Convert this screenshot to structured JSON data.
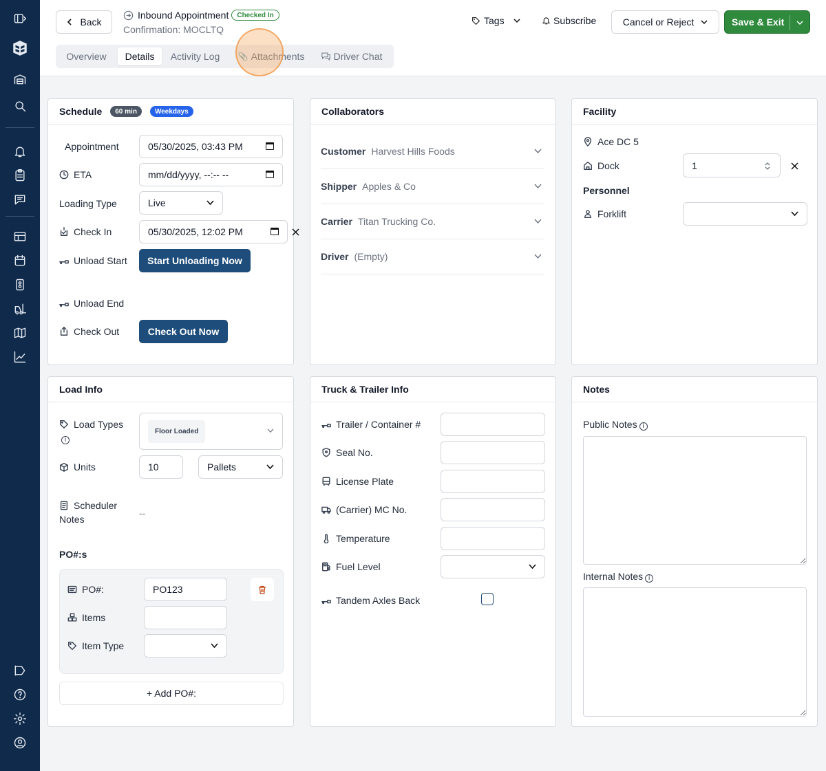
{
  "header": {
    "back_label": "Back",
    "title": "Inbound Appointment",
    "status_badge": "Checked In",
    "confirmation": "Confirmation: MOCLTQ",
    "tags_label": "Tags",
    "subscribe_label": "Subscribe",
    "cancel_label": "Cancel or Reject",
    "save_label": "Save & Exit",
    "tabs": [
      {
        "label": "Overview",
        "active": false
      },
      {
        "label": "Details",
        "active": true
      },
      {
        "label": "Activity Log",
        "active": false
      },
      {
        "label": "Attachments",
        "active": false
      },
      {
        "label": "Driver Chat",
        "active": false
      }
    ]
  },
  "schedule": {
    "title": "Schedule",
    "duration_badge": "60 min",
    "weekdays_badge": "Weekdays",
    "appointment_label": "Appointment",
    "appointment_value": "05/30/2025, 03:43 PM",
    "eta_label": "ETA",
    "eta_placeholder": "mm/dd/yyyy, --:-- --",
    "loading_type_label": "Loading Type",
    "loading_type_value": "Live",
    "check_in_label": "Check In",
    "check_in_value": "05/30/2025, 12:02 PM",
    "unload_start_label": "Unload Start",
    "start_unloading_label": "Start Unloading Now",
    "unload_end_label": "Unload End",
    "check_out_label": "Check Out",
    "check_out_button": "Check Out Now"
  },
  "collaborators": {
    "title": "Collaborators",
    "rows": [
      {
        "key": "Customer",
        "value": "Harvest Hills Foods"
      },
      {
        "key": "Shipper",
        "value": "Apples & Co"
      },
      {
        "key": "Carrier",
        "value": "Titan Trucking Co."
      },
      {
        "key": "Driver",
        "value": "(Empty)"
      }
    ]
  },
  "facility": {
    "title": "Facility",
    "name": "Ace DC 5",
    "dock_label": "Dock",
    "dock_value": "1",
    "personnel_label": "Personnel",
    "forklift_label": "Forklift"
  },
  "load_info": {
    "title": "Load Info",
    "load_types_label": "Load Types",
    "load_type_chip": "Floor Loaded",
    "units_label": "Units",
    "units_value": "10",
    "units_type": "Pallets",
    "scheduler_notes_label": "Scheduler Notes",
    "scheduler_notes_value": "--",
    "po_section_label": "PO#:s",
    "po_label": "PO#:",
    "po_value": "PO123",
    "items_label": "Items",
    "item_type_label": "Item Type",
    "add_po_label": "+ Add PO#:"
  },
  "truck": {
    "title": "Truck & Trailer Info",
    "fields": [
      {
        "label": "Trailer / Container #",
        "icon": "trailer-icon"
      },
      {
        "label": "Seal No.",
        "icon": "shield-icon"
      },
      {
        "label": "License Plate",
        "icon": "bus-icon"
      },
      {
        "label": "(Carrier) MC No.",
        "icon": "truck-icon"
      },
      {
        "label": "Temperature",
        "icon": "thermometer-icon"
      }
    ],
    "fuel_label": "Fuel Level",
    "tandem_label": "Tandem Axles Back"
  },
  "notes": {
    "title": "Notes",
    "public_label": "Public Notes",
    "internal_label": "Internal Notes"
  },
  "colors": {
    "sidebar": "#0f2a4a",
    "primary": "#1e4d7b",
    "success": "#2f8a3e",
    "badge_blue": "#2563eb",
    "badge_gray": "#4b5563"
  }
}
